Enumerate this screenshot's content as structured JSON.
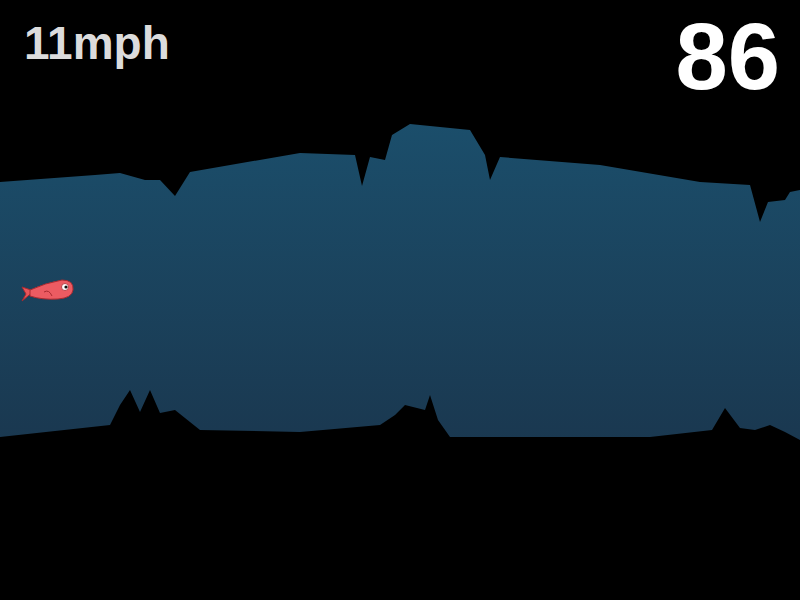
{
  "hud": {
    "speed": "11mph",
    "score": "86"
  }
}
